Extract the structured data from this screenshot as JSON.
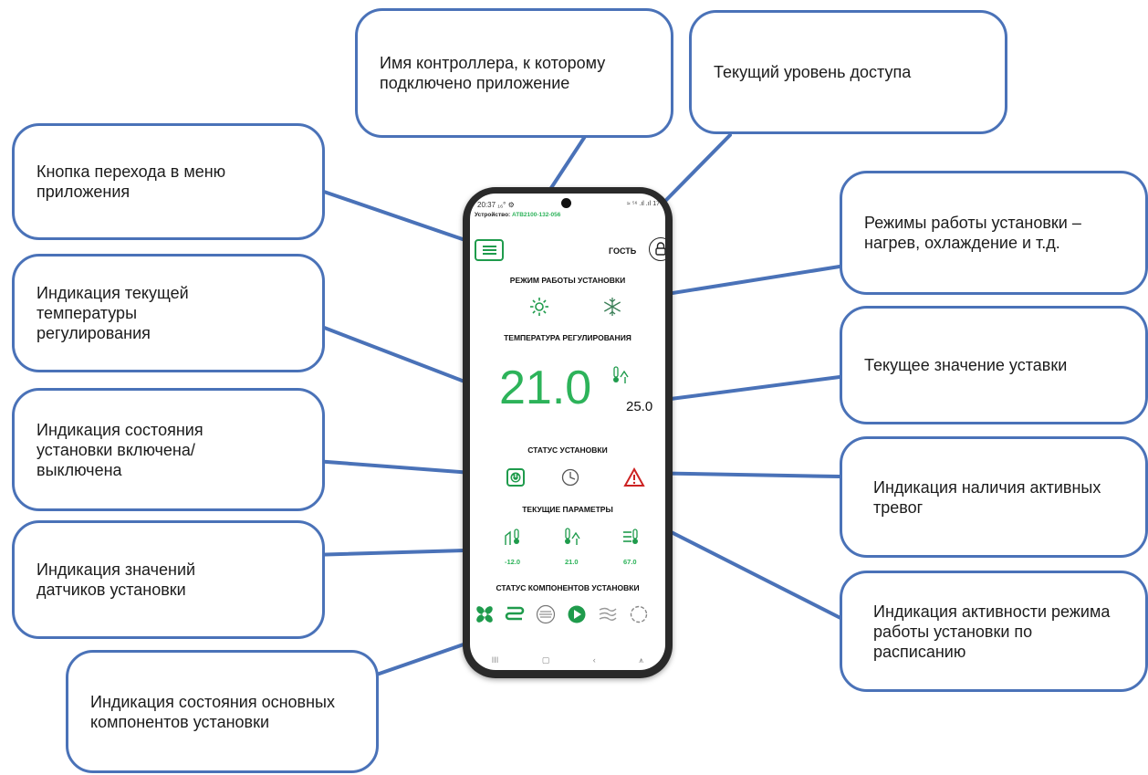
{
  "callouts": {
    "controller_name": "Имя контроллера, к которому подключено приложение",
    "access_level": "Текущий уровень доступа",
    "menu_button": "Кнопка перехода в меню приложения",
    "operating_modes": "Режимы работы установки – нагрев, охлаждение и т.д.",
    "current_temperature": "Индикация текущей температуры регулирования",
    "setpoint_value": "Текущее значение уставки",
    "unit_state": "Индикация состояния установки включена/выключена",
    "active_alarms": "Индикация наличия активных тревог",
    "sensor_values": "Индикация значений датчиков установки",
    "schedule_activity": "Индикация активности режима работы установки по расписанию",
    "components_state": "Индикация состояния основных компонентов установки"
  },
  "phone": {
    "status_time": "20:37 ₁₆° ⚙",
    "status_icons": "≈ ⁵⁶ .ıl .ıl 17",
    "device_label": "Устройство:",
    "device_name": "ATB2100-132-056",
    "access_user": "ГОСТЬ",
    "mode_title": "РЕЖИМ РАБОТЫ УСТАНОВКИ",
    "temp_title": "ТЕМПЕРАТУРА РЕГУЛИРОВАНИЯ",
    "current_temp": "21.0",
    "setpoint": "25.0",
    "status_title": "СТАТУС УСТАНОВКИ",
    "params_title": "ТЕКУЩИЕ ПАРАМЕТРЫ",
    "params": [
      "-12.0",
      "21.0",
      "67.0"
    ],
    "components_title": "СТАТУС КОМПОНЕНТОВ УСТАНОВКИ",
    "nav": [
      "III",
      "▢",
      "‹",
      "⩚"
    ]
  },
  "icons": {
    "menu": "hamburger-icon",
    "lock": "lock-icon",
    "heat": "sun-icon",
    "cool": "snowflake-icon",
    "power": "power-icon",
    "schedule": "clock-icon",
    "alarm": "warning-icon",
    "outdoor_sensor": "outdoor-thermometer-icon",
    "room_sensor": "room-thermometer-icon",
    "supply_sensor": "supply-thermometer-icon",
    "components": [
      "fan-icon",
      "heater-icon",
      "filter-icon",
      "pump-icon",
      "airflow-icon",
      "recuperator-icon"
    ]
  },
  "colors": {
    "accent": "#2db35a",
    "callout_border": "#4a72b8",
    "alarm": "#cc2222"
  }
}
